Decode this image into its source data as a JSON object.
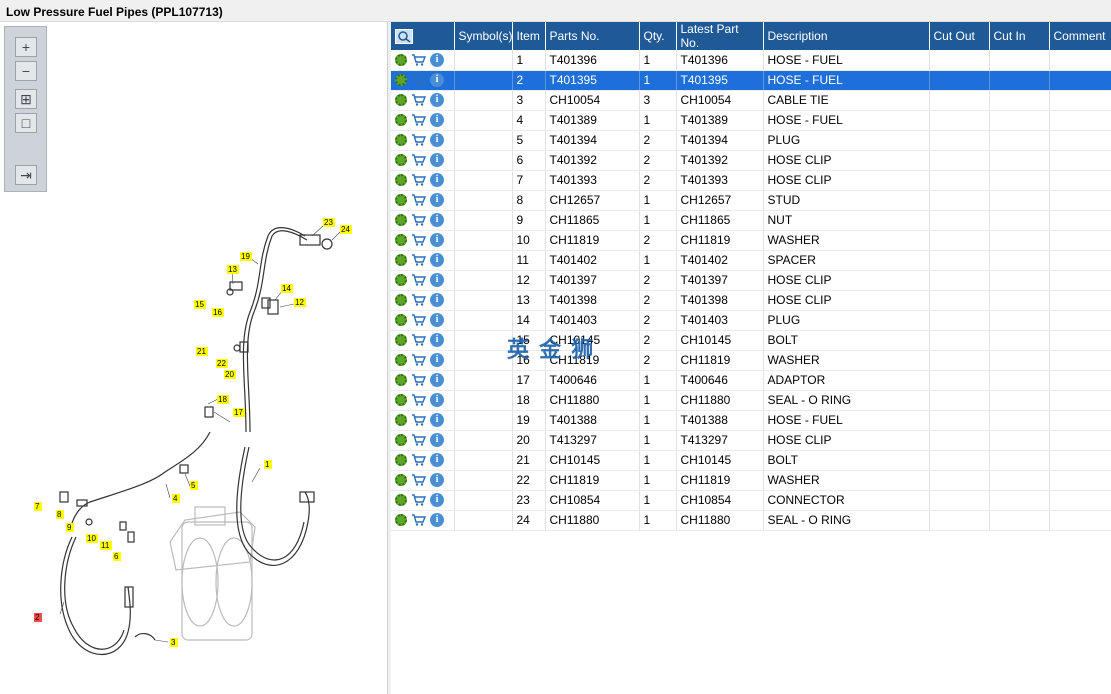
{
  "window": {
    "title": "Low Pressure Fuel Pipes (PPL107713)"
  },
  "toolbar": {
    "zoom_in": "+",
    "zoom_out": "−",
    "fit": "⊞",
    "actual": "□",
    "toggle": "⇥"
  },
  "diagram": {
    "callouts": [
      "1",
      "2",
      "3",
      "4",
      "5",
      "6",
      "7",
      "8",
      "9",
      "10",
      "11",
      "12",
      "13",
      "14",
      "15",
      "16",
      "17",
      "18",
      "19",
      "20",
      "21",
      "22",
      "23",
      "24"
    ],
    "highlighted": "2"
  },
  "table": {
    "columns": [
      "Symbol(s)",
      "Item",
      "Parts No.",
      "Qty.",
      "Latest Part No.",
      "Description",
      "Cut Out",
      "Cut In",
      "Comment"
    ],
    "rows": [
      {
        "item": "1",
        "part": "T401396",
        "qty": "1",
        "latest": "T401396",
        "desc": "HOSE - FUEL"
      },
      {
        "item": "2",
        "part": "T401395",
        "qty": "1",
        "latest": "T401395",
        "desc": "HOSE - FUEL"
      },
      {
        "item": "3",
        "part": "CH10054",
        "qty": "3",
        "latest": "CH10054",
        "desc": "CABLE TIE"
      },
      {
        "item": "4",
        "part": "T401389",
        "qty": "1",
        "latest": "T401389",
        "desc": "HOSE - FUEL"
      },
      {
        "item": "5",
        "part": "T401394",
        "qty": "2",
        "latest": "T401394",
        "desc": "PLUG"
      },
      {
        "item": "6",
        "part": "T401392",
        "qty": "2",
        "latest": "T401392",
        "desc": "HOSE CLIP"
      },
      {
        "item": "7",
        "part": "T401393",
        "qty": "2",
        "latest": "T401393",
        "desc": "HOSE CLIP"
      },
      {
        "item": "8",
        "part": "CH12657",
        "qty": "1",
        "latest": "CH12657",
        "desc": "STUD"
      },
      {
        "item": "9",
        "part": "CH11865",
        "qty": "1",
        "latest": "CH11865",
        "desc": "NUT"
      },
      {
        "item": "10",
        "part": "CH11819",
        "qty": "2",
        "latest": "CH11819",
        "desc": "WASHER"
      },
      {
        "item": "11",
        "part": "T401402",
        "qty": "1",
        "latest": "T401402",
        "desc": "SPACER"
      },
      {
        "item": "12",
        "part": "T401397",
        "qty": "2",
        "latest": "T401397",
        "desc": "HOSE CLIP"
      },
      {
        "item": "13",
        "part": "T401398",
        "qty": "2",
        "latest": "T401398",
        "desc": "HOSE CLIP"
      },
      {
        "item": "14",
        "part": "T401403",
        "qty": "2",
        "latest": "T401403",
        "desc": "PLUG"
      },
      {
        "item": "15",
        "part": "CH10145",
        "qty": "2",
        "latest": "CH10145",
        "desc": "BOLT"
      },
      {
        "item": "16",
        "part": "CH11819",
        "qty": "2",
        "latest": "CH11819",
        "desc": "WASHER"
      },
      {
        "item": "17",
        "part": "T400646",
        "qty": "1",
        "latest": "T400646",
        "desc": "ADAPTOR"
      },
      {
        "item": "18",
        "part": "CH11880",
        "qty": "1",
        "latest": "CH11880",
        "desc": "SEAL - O RING"
      },
      {
        "item": "19",
        "part": "T401388",
        "qty": "1",
        "latest": "T401388",
        "desc": "HOSE - FUEL"
      },
      {
        "item": "20",
        "part": "T413297",
        "qty": "1",
        "latest": "T413297",
        "desc": "HOSE CLIP"
      },
      {
        "item": "21",
        "part": "CH10145",
        "qty": "1",
        "latest": "CH10145",
        "desc": "BOLT"
      },
      {
        "item": "22",
        "part": "CH11819",
        "qty": "1",
        "latest": "CH11819",
        "desc": "WASHER"
      },
      {
        "item": "23",
        "part": "CH10854",
        "qty": "1",
        "latest": "CH10854",
        "desc": "CONNECTOR"
      },
      {
        "item": "24",
        "part": "CH11880",
        "qty": "1",
        "latest": "CH11880",
        "desc": "SEAL - O RING"
      }
    ],
    "selected_item": "2"
  },
  "watermark": "英 金 狮",
  "colors": {
    "header_bg": "#1f5a96",
    "selected_bg": "#1e6fd9",
    "callout_bg": "#ffff00",
    "highlight_callout_bg": "#ff4a4a"
  }
}
